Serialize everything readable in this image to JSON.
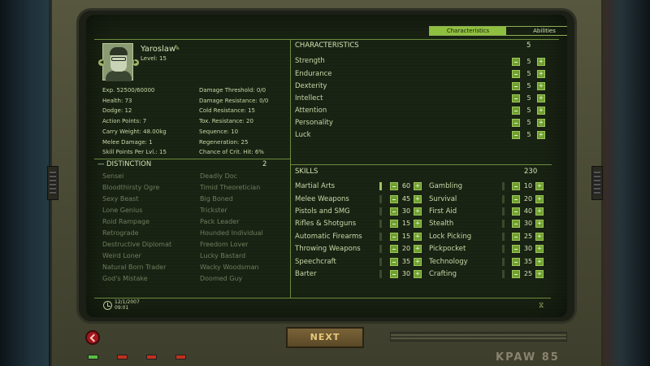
{
  "tabs": [
    "Characteristics",
    "Abilities"
  ],
  "character": {
    "name": "Yaroslaw",
    "level": "Level: 15",
    "stats_left": [
      "Exp. 52500/60000",
      "Health: 73",
      "Dodge: 12",
      "Action Points: 7",
      "Carry Weight: 48.00kg",
      "Melee Damage: 1",
      "Skill Points Per Lvl.: 15"
    ],
    "stats_right": [
      "Damage Threshold: 0/0",
      "Damage Resistance: 0/0",
      "Cold Resistance: 15",
      "Tox. Resistance: 20",
      "Sequence: 10",
      "Regeneration: 25",
      "Chance of Crit. Hit: 6%"
    ]
  },
  "distinction": {
    "title": "DISTINCTION",
    "count": "2",
    "col1": [
      "Sensei",
      "Bloodthirsty Ogre",
      "Sexy Beast",
      "Lone Genius",
      "Roid Rampage",
      "Retrograde",
      "Destructive Diplomat",
      "Weird Loner",
      "Natural Born Trader",
      "God's Mistake"
    ],
    "col2": [
      "Deadly Doc",
      "Timid Theoretician",
      "Big Boned",
      "Trickster",
      "Pack Leader",
      "Hounded Individual",
      "Freedom Lover",
      "Lucky Bastard",
      "Wacky Woodsman",
      "Doomed Guy"
    ]
  },
  "characteristics": {
    "title": "CHARACTERISTICS",
    "points": "5",
    "items": [
      {
        "name": "Strength",
        "value": "5"
      },
      {
        "name": "Endurance",
        "value": "5"
      },
      {
        "name": "Dexterity",
        "value": "5"
      },
      {
        "name": "Intellect",
        "value": "5"
      },
      {
        "name": "Attention",
        "value": "5"
      },
      {
        "name": "Personality",
        "value": "5"
      },
      {
        "name": "Luck",
        "value": "5"
      }
    ]
  },
  "skills": {
    "title": "SKILLS",
    "points": "230",
    "left": [
      {
        "name": "Martial Arts",
        "value": "60"
      },
      {
        "name": "Melee Weapons",
        "value": "45"
      },
      {
        "name": "Pistols and SMG",
        "value": "30"
      },
      {
        "name": "Rifles & Shotguns",
        "value": "15"
      },
      {
        "name": "Automatic Firearms",
        "value": "15"
      },
      {
        "name": "Throwing Weapons",
        "value": "20"
      },
      {
        "name": "Speechcraft",
        "value": "35"
      },
      {
        "name": "Barter",
        "value": "30"
      }
    ],
    "right": [
      {
        "name": "Gambling",
        "value": "10"
      },
      {
        "name": "Survival",
        "value": "20"
      },
      {
        "name": "First Aid",
        "value": "40"
      },
      {
        "name": "Stealth",
        "value": "30"
      },
      {
        "name": "Lock Picking",
        "value": "25"
      },
      {
        "name": "Pickpocket",
        "value": "30"
      },
      {
        "name": "Technology",
        "value": "35"
      },
      {
        "name": "Crafting",
        "value": "25"
      }
    ]
  },
  "footer": {
    "date": "12/1/2007",
    "time": "09:01"
  },
  "next_label": "NEXT",
  "brand": "KPAW 85"
}
